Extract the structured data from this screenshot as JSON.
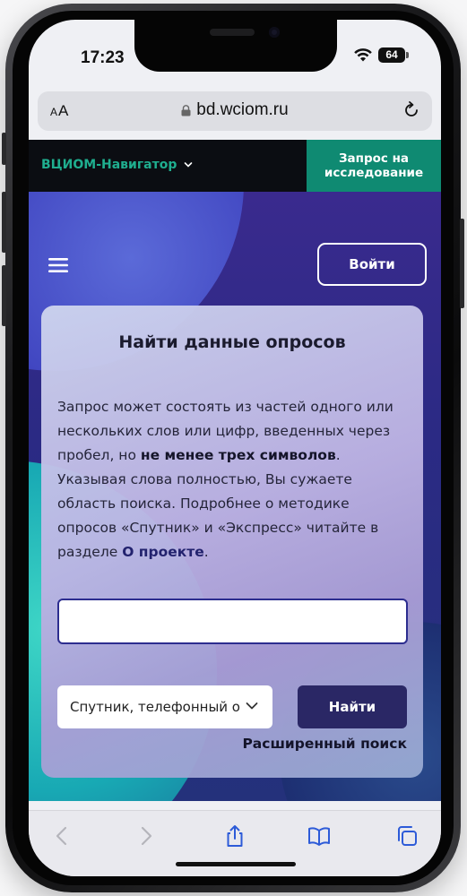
{
  "status_bar": {
    "time": "17:23",
    "battery": "64"
  },
  "browser": {
    "text_size_label": "AA",
    "url": "bd.wciom.ru"
  },
  "site_header": {
    "brand": "ВЦИОМ-Навигатор",
    "request_button": "Запрос на исследование"
  },
  "hero": {
    "login_button": "Войти"
  },
  "search": {
    "title": "Найти данные опросов",
    "desc_part1": "Запрос может состоять из частей одного или нескольких слов или цифр, введенных через пробел, но ",
    "desc_bold": "не менее трех символов",
    "desc_part2": ". Указывая слова полностью, Вы сужаете область поиска. Подробнее о методике опросов «Спутник» и «Экспресс» читайте в разделе ",
    "desc_link": "О проекте",
    "desc_end": ".",
    "input_value": "",
    "input_placeholder": "",
    "survey_type_selected": "Спутник, телефонный опрос",
    "find_button": "Найти",
    "advanced_link": "Расширенный поиск"
  },
  "toolbar": {
    "icons": [
      "back-icon",
      "forward-icon",
      "share-icon",
      "bookmarks-icon",
      "tabs-icon"
    ]
  },
  "colors": {
    "brand_green": "#1fae8f",
    "request_button_bg": "#0f8a72",
    "hero_bg": "#2b2a84",
    "find_button_bg": "#2a2765"
  }
}
